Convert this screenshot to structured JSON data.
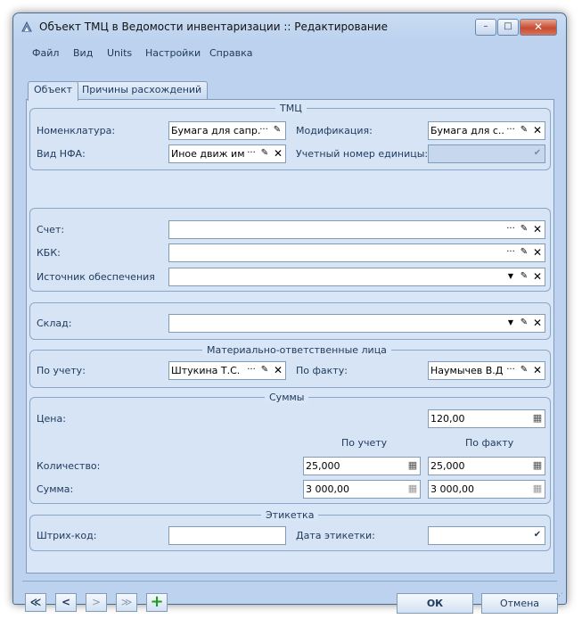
{
  "window": {
    "title": "Объект ТМЦ в Ведомости инвентаризации :: Редактирование",
    "minimize": "–",
    "maximize": "□",
    "close": "✕"
  },
  "menu": [
    "Файл",
    "Вид",
    "Units",
    "Настройки",
    "Справка"
  ],
  "tabs": [
    {
      "label": "Объект",
      "active": true
    },
    {
      "label": "Причины расхождений",
      "active": false
    }
  ],
  "tmc": {
    "title": "ТМЦ",
    "nomenclature_label": "Номенклатура:",
    "nomenclature_value": "Бумага  для сапр.",
    "modification_label": "Модификация:",
    "modification_value": "Бумага  для с...",
    "nfa_label": "Вид НФА:",
    "nfa_value": "Иное движ иму",
    "unit_number_label": "Учетный номер единицы:",
    "unit_number_value": ""
  },
  "accounts": {
    "account_label": "Счет:",
    "account_value": "",
    "kbk_label": "КБК:",
    "kbk_value": "",
    "source_label": "Источник обеспечения",
    "source_value": ""
  },
  "warehouse": {
    "label": "Склад:",
    "value": ""
  },
  "responsible": {
    "title": "Материально-ответственные лица",
    "by_record_label": "По учету:",
    "by_record_value": "Штукина Т.С.",
    "by_fact_label": "По факту:",
    "by_fact_value": "Наумычев В.Д."
  },
  "sums": {
    "title": "Суммы",
    "price_label": "Цена:",
    "price_value": "120,00",
    "col_record": "По учету",
    "col_fact": "По факту",
    "qty_label": "Количество:",
    "qty_record": "25,000",
    "qty_fact": "25,000",
    "sum_label": "Сумма:",
    "sum_record": "3 000,00",
    "sum_fact": "3 000,00"
  },
  "label_group": {
    "title": "Этикетка",
    "barcode_label": "Штрих-код:",
    "barcode_value": "",
    "date_label": "Дата этикетки:",
    "date_value": ""
  },
  "nav": {
    "first": "≪",
    "prev": "<",
    "next": ">",
    "last": "≫",
    "add": "+"
  },
  "buttons": {
    "ok": "ОК",
    "cancel": "Отмена"
  },
  "glyphs": {
    "dots": "···",
    "pencil": "✎",
    "clear": "✕",
    "dropdown": "▼",
    "check": "✔",
    "calc": "▦"
  },
  "icons": {
    "window_icon": "app-icon",
    "lookup": "ellipsis-icon",
    "edit": "pencil-icon",
    "clear": "close-icon",
    "dropdown": "chevron-down-icon",
    "calculator": "calculator-icon",
    "add": "plus-icon"
  },
  "colors": {
    "frame": "#bcd2ee",
    "panel": "#d9e6f7",
    "border": "#7f9db9",
    "text": "#1e395b",
    "close_button": "#c64b2f",
    "add_icon": "#1f9b1f"
  }
}
